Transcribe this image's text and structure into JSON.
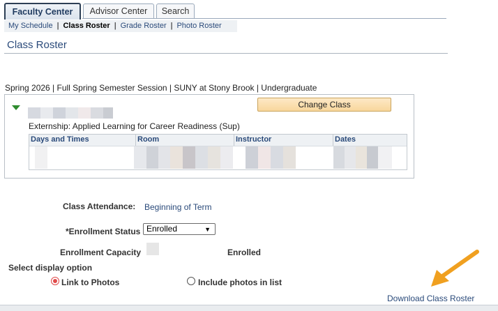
{
  "tabs": [
    {
      "label": "Faculty Center",
      "active": true
    },
    {
      "label": "Advisor Center",
      "active": false
    },
    {
      "label": "Search",
      "active": false
    }
  ],
  "subnav": [
    "My Schedule",
    "Class Roster",
    "Grade Roster",
    "Photo Roster"
  ],
  "page_title": "Class Roster",
  "term_line": "Spring 2026 | Full Spring Semester Session | SUNY at Stony Brook | Undergraduate",
  "class_section": {
    "change_button": "Change Class",
    "description": "Externship: Applied Learning for Career Readiness (Sup)",
    "columns": [
      "Days and Times",
      "Room",
      "Instructor",
      "Dates"
    ]
  },
  "fields": {
    "attendance_label": "Class Attendance:",
    "attendance_value": "Beginning of Term",
    "enrollment_status_label": "*Enrollment Status",
    "enrollment_status_value": "Enrolled",
    "capacity_label": "Enrollment Capacity",
    "enrolled_label": "Enrolled"
  },
  "display_option": {
    "heading": "Select display option",
    "options": [
      {
        "label": "Link to Photos",
        "selected": true
      },
      {
        "label": "Include photos in list",
        "selected": false
      }
    ]
  },
  "download_link": "Download Class Roster",
  "colors": {
    "link": "#2a4a7a",
    "change_button_bg": "#f8d79c",
    "radio_selected": "#e04a4a",
    "arrow": "#f0a020"
  }
}
